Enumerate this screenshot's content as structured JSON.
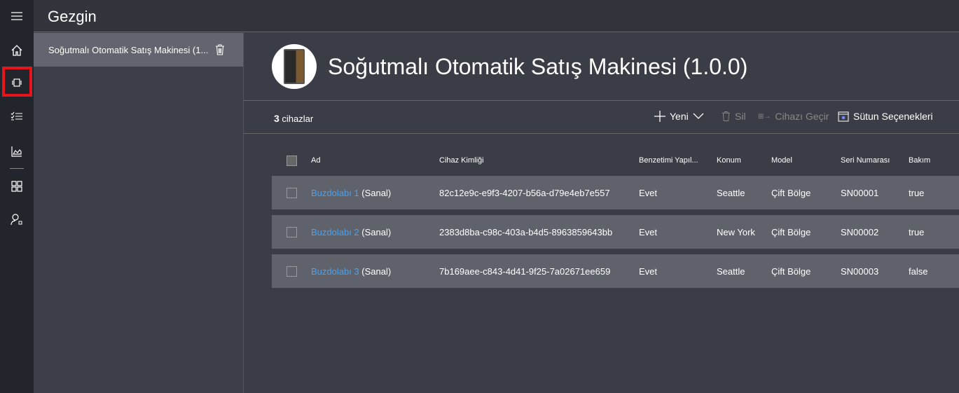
{
  "app": {
    "title": "Gezgin"
  },
  "nav": [
    "menu-icon",
    "home-icon",
    "devices-icon",
    "rules-icon",
    "analytics-icon",
    "dashboard-icon",
    "admin-icon"
  ],
  "side": {
    "item": "Soğutmalı Otomatik Satış Makinesi (1..."
  },
  "header": {
    "title": "Soğutmalı Otomatik Satış Makinesi (1.0.0)"
  },
  "toolbar": {
    "count": "3",
    "count_label": "cihazlar",
    "new": "Yeni",
    "delete": "Sil",
    "migrate": "Cihazı Geçir",
    "columns": "Sütun Seçenekleri"
  },
  "table": {
    "headers": [
      "Ad",
      "Cihaz Kimliği",
      "Benzetimi Yapıl...",
      "Konum",
      "Model",
      "Seri Numarası",
      "Bakım"
    ],
    "rows": [
      {
        "name": "Buzdolabı 1",
        "tag": "(Sanal)",
        "id": "82c12e9c-e9f3-4207-b56a-d79e4eb7e557",
        "sim": "Evet",
        "loc": "Seattle",
        "model": "Çift Bölge",
        "serial": "SN00001",
        "maint": "true"
      },
      {
        "name": "Buzdolabı 2",
        "tag": "(Sanal)",
        "id": "2383d8ba-c98c-403a-b4d5-8963859643bb",
        "sim": "Evet",
        "loc": "New York",
        "model": "Çift Bölge",
        "serial": "SN00002",
        "maint": "true"
      },
      {
        "name": "Buzdolabı 3",
        "tag": "(Sanal)",
        "id": "7b169aee-c843-4d41-9f25-7a02671ee659",
        "sim": "Evet",
        "loc": "Seattle",
        "model": "Çift Bölge",
        "serial": "SN00003",
        "maint": "false"
      }
    ]
  },
  "colors": {
    "link": "#4aa2f0",
    "highlight": "#e8141c"
  }
}
